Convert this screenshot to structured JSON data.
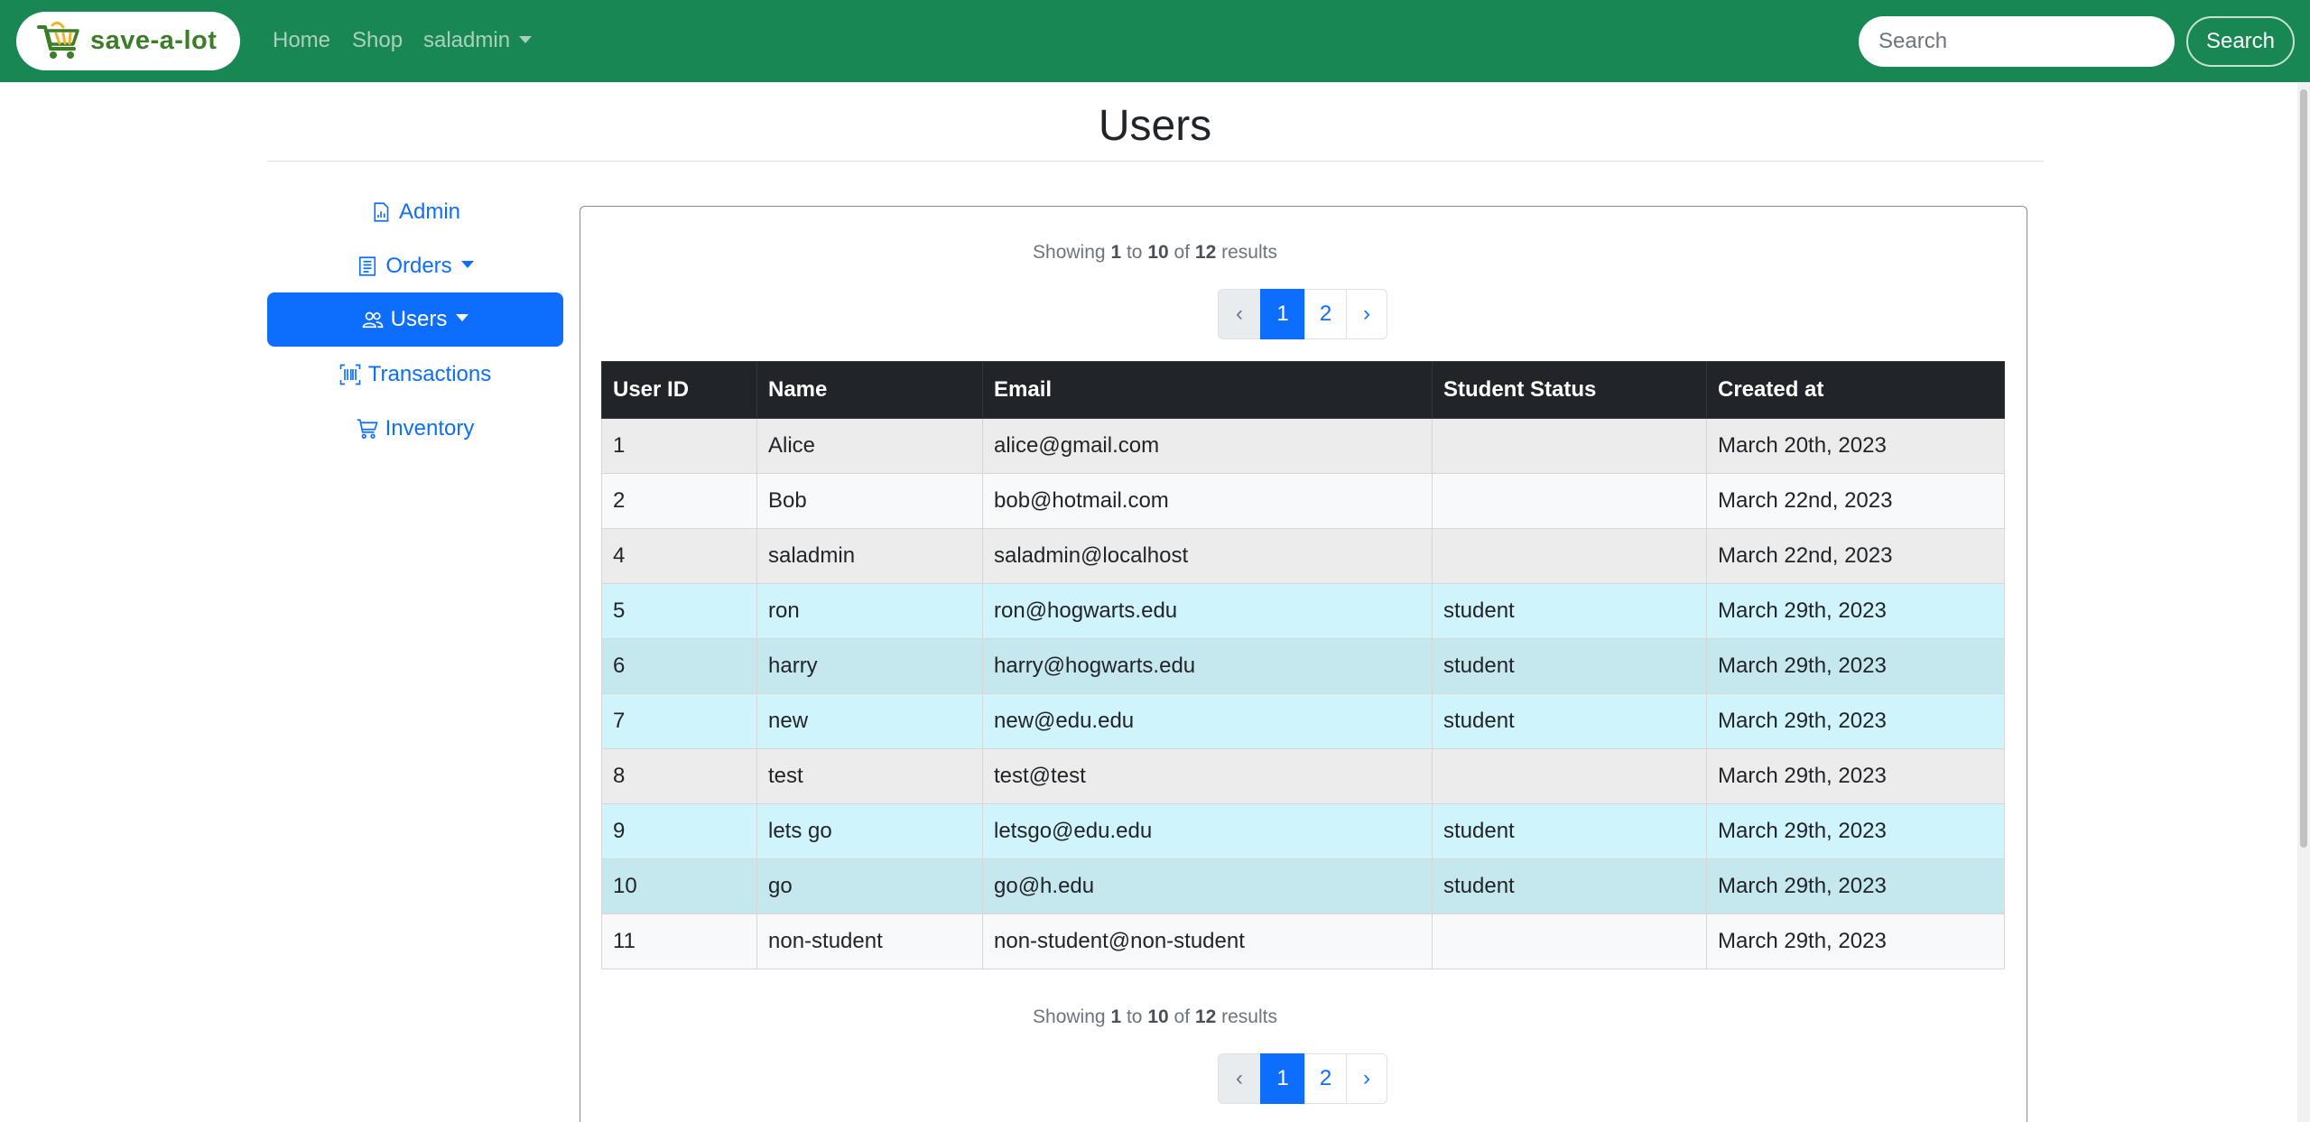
{
  "navbar": {
    "brand": "save-a-lot",
    "links": {
      "home": "Home",
      "shop": "Shop",
      "user": "saladmin"
    },
    "search_placeholder": "Search",
    "search_button": "Search",
    "color": "#198754"
  },
  "page": {
    "title": "Users"
  },
  "sidebar": {
    "items": [
      {
        "label": "Admin",
        "icon": "file-chart-icon"
      },
      {
        "label": "Orders",
        "icon": "receipt-icon"
      },
      {
        "label": "Users",
        "icon": "people-icon",
        "active": true
      },
      {
        "label": "Transactions",
        "icon": "barcode-icon"
      },
      {
        "label": "Inventory",
        "icon": "cart-icon"
      }
    ]
  },
  "pagination": {
    "showing_prefix": "Showing",
    "from": "1",
    "to_word": "to",
    "to": "10",
    "of_word": "of",
    "total": "12",
    "results_word": "results",
    "prev": "‹",
    "pages": [
      "1",
      "2"
    ],
    "current": "1",
    "next": "›"
  },
  "table": {
    "headers": [
      "User ID",
      "Name",
      "Email",
      "Student Status",
      "Created at"
    ],
    "rows": [
      {
        "id": "1",
        "name": "Alice",
        "email": "alice@gmail.com",
        "status": "",
        "created": "March 20th, 2023"
      },
      {
        "id": "2",
        "name": "Bob",
        "email": "bob@hotmail.com",
        "status": "",
        "created": "March 22nd, 2023"
      },
      {
        "id": "4",
        "name": "saladmin",
        "email": "saladmin@localhost",
        "status": "",
        "created": "March 22nd, 2023"
      },
      {
        "id": "5",
        "name": "ron",
        "email": "ron@hogwarts.edu",
        "status": "student",
        "created": "March 29th, 2023"
      },
      {
        "id": "6",
        "name": "harry",
        "email": "harry@hogwarts.edu",
        "status": "student",
        "created": "March 29th, 2023"
      },
      {
        "id": "7",
        "name": "new",
        "email": "new@edu.edu",
        "status": "student",
        "created": "March 29th, 2023"
      },
      {
        "id": "8",
        "name": "test",
        "email": "test@test",
        "status": "",
        "created": "March 29th, 2023"
      },
      {
        "id": "9",
        "name": "lets go",
        "email": "letsgo@edu.edu",
        "status": "student",
        "created": "March 29th, 2023"
      },
      {
        "id": "10",
        "name": "go",
        "email": "go@h.edu",
        "status": "student",
        "created": "March 29th, 2023"
      },
      {
        "id": "11",
        "name": "non-student",
        "email": "non-student@non-student",
        "status": "",
        "created": "March 29th, 2023"
      }
    ]
  }
}
